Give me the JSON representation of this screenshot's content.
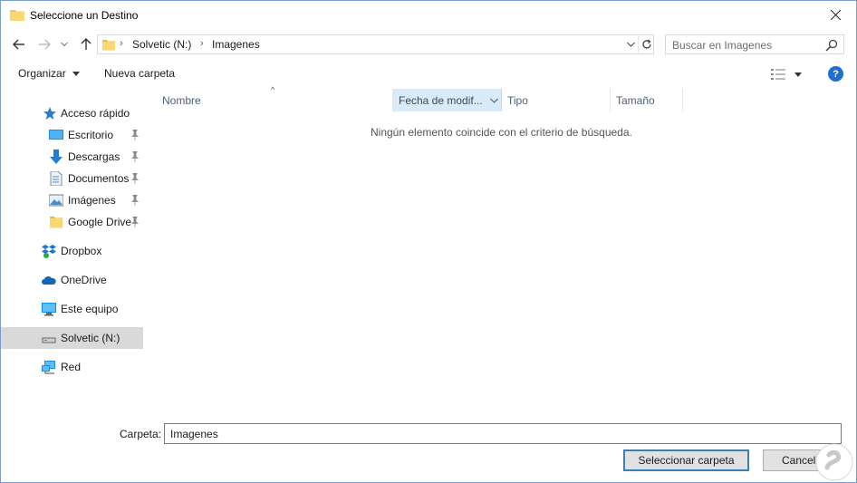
{
  "window": {
    "title": "Seleccione un Destino"
  },
  "address": {
    "crumbs": [
      "Solvetic (N:)",
      "Imagenes"
    ],
    "search_placeholder": "Buscar en Imagenes"
  },
  "toolbar": {
    "organize_label": "Organizar",
    "new_folder_label": "Nueva carpeta"
  },
  "sidebar": {
    "items": [
      {
        "label": "Acceso rápido",
        "icon": "star-icon"
      },
      {
        "label": "Escritorio",
        "icon": "desktop-icon",
        "pinned": true
      },
      {
        "label": "Descargas",
        "icon": "download-icon",
        "pinned": true
      },
      {
        "label": "Documentos",
        "icon": "document-icon",
        "pinned": true
      },
      {
        "label": "Imágenes",
        "icon": "pictures-icon",
        "pinned": true
      },
      {
        "label": "Google Drive",
        "icon": "folder-icon",
        "pinned": true
      },
      {
        "label": "Dropbox",
        "icon": "dropbox-icon"
      },
      {
        "label": "OneDrive",
        "icon": "onedrive-icon"
      },
      {
        "label": "Este equipo",
        "icon": "computer-icon"
      },
      {
        "label": "Solvetic (N:)",
        "icon": "drive-icon",
        "selected": true
      },
      {
        "label": "Red",
        "icon": "network-icon"
      }
    ]
  },
  "filelist": {
    "columns": [
      "Nombre",
      "Fecha de modif...",
      "Tipo",
      "Tamaño"
    ],
    "empty_message": "Ningún elemento coincide con el criterio de búsqueda."
  },
  "footer": {
    "folder_label": "Carpeta:",
    "folder_value": "Imagenes",
    "select_button": "Seleccionar carpeta",
    "cancel_button": "Cancelar"
  },
  "colors": {
    "accent": "#1e6fd0",
    "selection": "#d9d9d9",
    "header_highlight": "#d9ebf9"
  }
}
